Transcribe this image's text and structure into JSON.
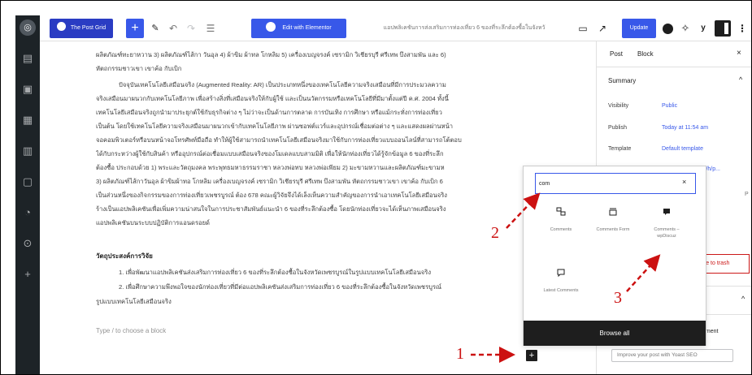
{
  "toolbar": {
    "post_grid_label": "The Post Grid",
    "add_label": "+",
    "tools_icon": "✎",
    "undo_icon": "↶",
    "redo_icon": "↷",
    "outline_icon": "☰",
    "elementor_label": "Edit with Elementor",
    "doc_title": "แอปพลิเคชันการส่งเสริมการท่องเที่ยว 6 ของที่ระลึกต้องซื้อในจังหวั",
    "preview_icon": "▭",
    "external_icon": "↗",
    "update_label": "Update",
    "sparkle_icon": "✧",
    "yoast_icon": "y",
    "more_icon": "⋮",
    "accent": "#3858e9",
    "post_grid_color": "#2a3cc3"
  },
  "admin_sidebar": {
    "logo": "◎",
    "icons": [
      "▤",
      "▣",
      "▦",
      "▥",
      "▢",
      "◔",
      "⊙",
      "+"
    ]
  },
  "content": {
    "p1_lines": [
      "ผลิตภัณฑ์ทะยาหวาน 3) ผลิตภัณฑ์ไส้กา วันอุล 4) ผ้าขิม ผ้าทล โกหลิม 5) เครื่องเบญจรงค์ เซรามิก วิเชียรบุรี ศรีเทพ บึงสามพัน และ 6)",
      "หัตถกรรมชาวเขา เขาค้อ กับเบิก"
    ],
    "p2_lines": [
      "ปัจจุบันเทคโนโลยีเสมือนจริง (Augmented Reality: AR) เป็นประเภทหนึ่งของเทคโนโลยีความจริงเสมือนที่มีการประมวลความ",
      "จริงเสมือนมาผนวกกับเทคโนโลยีภาพ เพื่อสร้างสิ่งที่เสมือนจริงให้กับผู้ใช้ และเป็นนวัตกรรมหรือเทคโนโลยีที่มีมาตั้งแต่ปี ค.ศ. 2004 ทั้งนี้",
      "เทคโนโลยีเสมือนจริงถูกนำมาประยุกต์ใช้กับธุรกิจต่าง ๆ ไม่ว่าจะเป็นด้านการตลาด การบันเทิง การศึกษา หรือแม้กระทั่งการท่องเที่ยว",
      "เป็นต้น โดยใช้เทคโนโลยีความจริงเสมือนมาผนวกเข้ากับเทคโนโลยีภาพ ผ่านซอฟต์แวร์และอุปกรณ์เชื่อมต่อต่าง ๆ และแสดงผลผ่านหน้า",
      "จอคอมพิวเตอร์หรือบนหน้าจอโทรศัพท์มือถือ ทำให้ผู้ใช้สามารถนำเทคโนโลยีเสมือนจริงมาใช้กับการท่องเที่ยวแบบออนไลน์ที่สามารถโต้ตอบ",
      "ได้กับกระหว่างผู้ใช้กับสินค้า หรืออุปกรณ์ต่อเชื่อมแบบเสมือนจริงของโมเดลแบบสามมิติ เพื่อให้นักท่องเที่ยวได้รู้จักข้อมูล 6 ของที่ระลึก",
      "ต้องซื้อ ประกอบด้วย 1) พระและวัตถุมงคล พระพุทธมหาธรรมราชา หลวงพ่อทบ หลวงพ่อเพียม 2) มะขามหวานและผลิตภัณฑ์มะขามห",
      "3) ผลิตภัณฑ์ไส้กาวันอุล ผ้าขิมผ้าทอ โกหลิม เครื่องเบญจรงค์ เซรามิก วิเชียรบุรี ศรีเทพ บึงสามพัน หัตถกรรมชาวเขา เขาค้อ กับเบิก 6",
      "เป็นส่วนหนึ่งของกิจกรรมของการท่องเที่ยวเพชรบูรณ์ ต้อง 678 คณะผู้วิจัยจึงได้เล็งเห็นความสำคัญของการนำเอาเทคโนโลยีเสมือนจริง",
      "ร้างเป็นแอปพลิเคชันเพื่อเพิ่มความน่าสนใจในการประชาสัมพันธ์แนะนำ 6 ของที่ระลึกต้องซื้อ โดยนักท่องเที่ยวจะได้เห็นภาพเสมือนจริง",
      "แอปพลิเคชันบนระบบปฏิบัติการแอนดรอยด์"
    ],
    "objectives_heading": "วัตถุประสงค์การวิจัย",
    "objective_1": "1.  เพื่อพัฒนาแอปพลิเคชันส่งเสริมการท่องเที่ยว 6 ของที่ระลึกต้องซื้อในจังหวัดเพชรบูรณ์ในรูปแบบเทคโนโลยีเสมือนจริง",
    "objective_2a": "2.  เพื่อศึกษาความพึงพอใจของนักท่องเที่ยวที่มีต่อแอปพลิเคชันส่งเสริมการท่องเที่ยว 6 ของที่ระลึกต้องซื้อในจังหวัดเพชรบูรณ์",
    "objective_2b": "รูปแบบเทคโนโลยีเสมือนจริง",
    "placeholder": "Type / to choose a block",
    "inserter_label": "+"
  },
  "right_panel": {
    "tab_post": "Post",
    "tab_block": "Block",
    "close_icon": "×",
    "summary_title": "Summary",
    "summary_chevron": "^",
    "visibility_label": "Visibility",
    "visibility_value": "Public",
    "publish_label": "Publish",
    "publish_value": "Today at 11:54 am",
    "template_label": "Template",
    "template_value": "Default template",
    "fragment": "wac/h/p...",
    "fragment2": "P",
    "trash_label": "Move to trash",
    "chevron2": "^",
    "ement_text": "ement",
    "yoast_button": "Improve your post with Yoast SEO"
  },
  "inserter_popover": {
    "search_value": "com",
    "clear_icon": "×",
    "blocks": [
      {
        "label": "Comments",
        "icon": "comments-icon"
      },
      {
        "label": "Comments Form",
        "icon": "comments-form-icon"
      },
      {
        "label": "Comments – wpDiscuz",
        "icon": "wpdiscuz-icon"
      },
      {
        "label": "Latest Comments",
        "icon": "latest-comments-icon"
      }
    ],
    "browse_all": "Browse all"
  },
  "annotations": {
    "step1": "1",
    "step2": "2",
    "step3": "3",
    "color": "#cc1111"
  }
}
